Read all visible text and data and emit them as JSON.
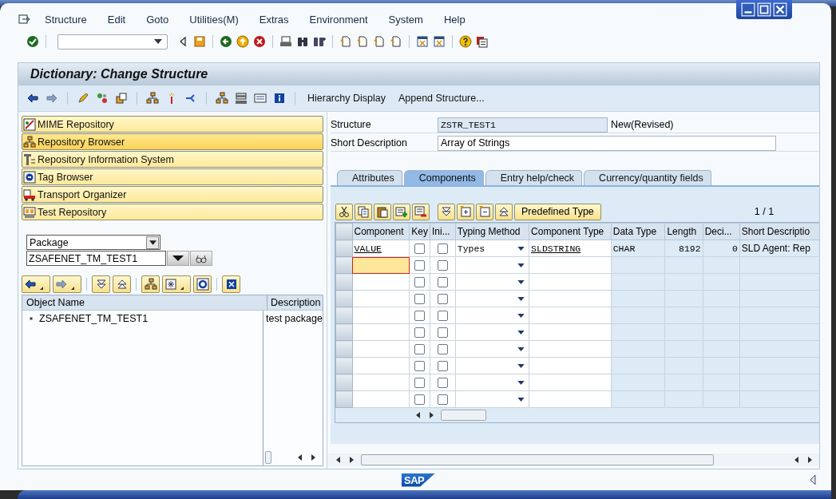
{
  "menu": [
    "Structure",
    "Edit",
    "Goto",
    "Utilities(M)",
    "Extras",
    "Environment",
    "System",
    "Help"
  ],
  "screen_title": "Dictionary: Change Structure",
  "app_toolbar": {
    "buttons": [
      "Hierarchy Display",
      "Append Structure..."
    ]
  },
  "navigation": [
    {
      "label": "MIME Repository",
      "selected": false
    },
    {
      "label": "Repository Browser",
      "selected": true
    },
    {
      "label": "Repository Information System",
      "selected": false
    },
    {
      "label": "Tag Browser",
      "selected": false
    },
    {
      "label": "Transport Organizer",
      "selected": false
    },
    {
      "label": "Test Repository",
      "selected": false
    }
  ],
  "object_selector": {
    "type": "Package",
    "name": "ZSAFENET_TM_TEST1"
  },
  "object_tree": {
    "columns": [
      "Object Name",
      "Description"
    ],
    "rows": [
      {
        "name": "ZSAFENET_TM_TEST1",
        "description": "test package"
      }
    ]
  },
  "header_fields": [
    {
      "label": "Structure",
      "value": "ZSTR_TEST1",
      "status": "New(Revised)",
      "editable": false
    },
    {
      "label": "Short Description",
      "value": "Array of Strings",
      "editable": true
    }
  ],
  "tabs": [
    {
      "label": "Attributes",
      "selected": false
    },
    {
      "label": "Components",
      "selected": true
    },
    {
      "label": "Entry help/check",
      "selected": false
    },
    {
      "label": "Currency/quantity fields",
      "selected": false
    }
  ],
  "components": {
    "button": "Predefined Type",
    "page": "1 / 1",
    "columns": [
      "Component",
      "Key",
      "Ini...",
      "Typing Method",
      "Component Type",
      "Data Type",
      "Length",
      "Deci...",
      "Short Descriptio"
    ],
    "rows": [
      {
        "component": "VALUE",
        "key": false,
        "initial": false,
        "focused": false,
        "typing_method": "Types",
        "component_type": "SLDSTRING",
        "data_type": "CHAR",
        "length": "8192",
        "decimals": "0",
        "short_description": "SLD Agent: Rep"
      },
      {
        "key": false,
        "initial": false,
        "focused": true
      },
      {
        "key": false,
        "initial": false,
        "focused": false
      },
      {
        "key": false,
        "initial": false,
        "focused": false
      },
      {
        "key": false,
        "initial": false,
        "focused": false
      },
      {
        "key": false,
        "initial": false,
        "focused": false
      },
      {
        "key": false,
        "initial": false,
        "focused": false
      },
      {
        "key": false,
        "initial": false,
        "focused": false
      },
      {
        "key": false,
        "initial": false,
        "focused": false
      },
      {
        "key": false,
        "initial": false,
        "focused": false
      }
    ]
  },
  "status_bar": {
    "logo": "SAP"
  }
}
